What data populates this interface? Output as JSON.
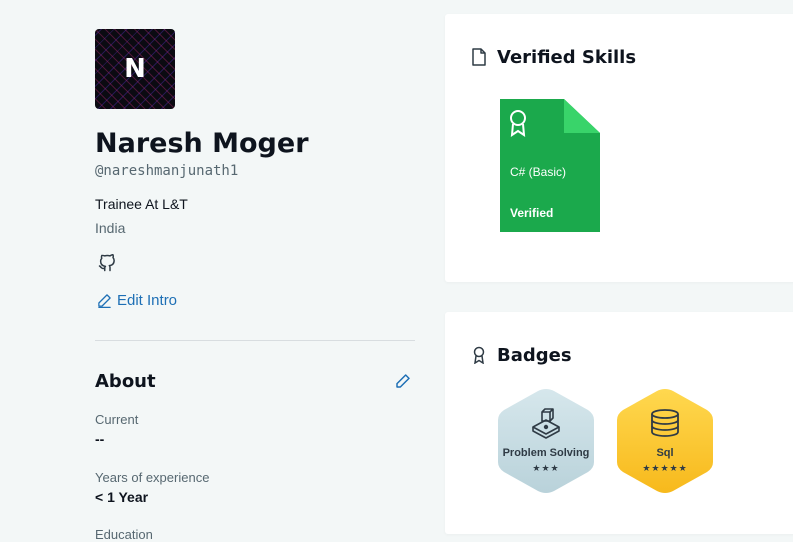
{
  "profile": {
    "avatar_initial": "N",
    "name": "Naresh Moger",
    "username": "@nareshmanjunath1",
    "job": "Trainee At L&T",
    "location": "India",
    "edit_intro": "Edit Intro"
  },
  "about": {
    "title": "About",
    "current_label": "Current",
    "current_value": "--",
    "experience_label": "Years of experience",
    "experience_value": "< 1 Year",
    "education_label": "Education"
  },
  "verified_skills": {
    "title": "Verified Skills",
    "items": [
      {
        "name": "C# (Basic)",
        "status": "Verified"
      }
    ]
  },
  "badges": {
    "title": "Badges",
    "items": [
      {
        "name": "Problem Solving",
        "stars": "★★★",
        "color": "#c9dde3"
      },
      {
        "name": "Sql",
        "stars": "★★★★★",
        "color": "#ffc72c"
      }
    ]
  }
}
